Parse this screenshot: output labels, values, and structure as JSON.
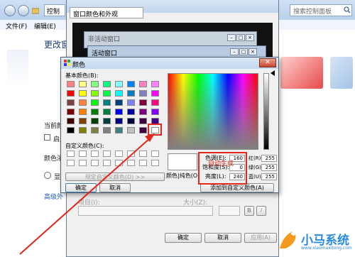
{
  "control_panel": {
    "address": "控制",
    "search_placeholder": "搜索控制面板",
    "menu": [
      "文件(F)",
      "编辑(E)"
    ],
    "heading": "更改窗",
    "side_texts": [
      "当前颜",
      "启用",
      "颜色浓",
      "显",
      "高级外"
    ]
  },
  "appearance_dialog": {
    "title": "窗口颜色和外观",
    "tab": "窗口颜色和外观",
    "inactive_window": "非活动窗口",
    "active_window": "活动窗口",
    "section_label": "项目(I):",
    "size_label": "大小(Z):",
    "buttons": {
      "ok": "确定",
      "cancel": "取消",
      "apply": "应用(A)"
    },
    "style_buttons": [
      "B",
      "I"
    ]
  },
  "color_dialog": {
    "title": "颜色",
    "basic_colors_label": "基本颜色(B):",
    "custom_colors_label": "自定义颜色(C):",
    "define_custom_button": "规定自定义颜色(D) >>",
    "ok_button": "确定",
    "cancel_button": "取消",
    "color_solid_label": "颜色|纯色(O)",
    "add_custom_button": "添加到自定义颜色(A)",
    "hue_label": "色调(E):",
    "hue": "160",
    "sat_label": "饱和度(S):",
    "sat": "0",
    "lum_label": "亮度(L):",
    "lum": "240",
    "red_label": "红(R):",
    "red": "255",
    "green_label": "绿(G):",
    "green": "255",
    "blue_label": "蓝(U):",
    "blue": "255",
    "annotation": "自动生成",
    "basic_colors": [
      [
        "#ff8080",
        "#ffff80",
        "#80ff80",
        "#00ff80",
        "#80ffff",
        "#0080ff",
        "#ff80c0",
        "#ff80ff"
      ],
      [
        "#ff0000",
        "#ffff00",
        "#80ff00",
        "#00ff40",
        "#00ffff",
        "#0080c0",
        "#8080c0",
        "#ff00ff"
      ],
      [
        "#804040",
        "#ff8040",
        "#00ff00",
        "#008080",
        "#004080",
        "#8080ff",
        "#800040",
        "#ff0080"
      ],
      [
        "#800000",
        "#ff8000",
        "#008000",
        "#008040",
        "#0000ff",
        "#0000a0",
        "#800080",
        "#8000ff"
      ],
      [
        "#400000",
        "#804000",
        "#004000",
        "#004040",
        "#000080",
        "#000040",
        "#400040",
        "#400080"
      ],
      [
        "#000000",
        "#808000",
        "#808040",
        "#808080",
        "#408080",
        "#c0c0c0",
        "#400040",
        "#ffffff"
      ]
    ]
  },
  "watermark": {
    "brand": "小马系统",
    "url": "www.xiaomaxitong.com"
  }
}
